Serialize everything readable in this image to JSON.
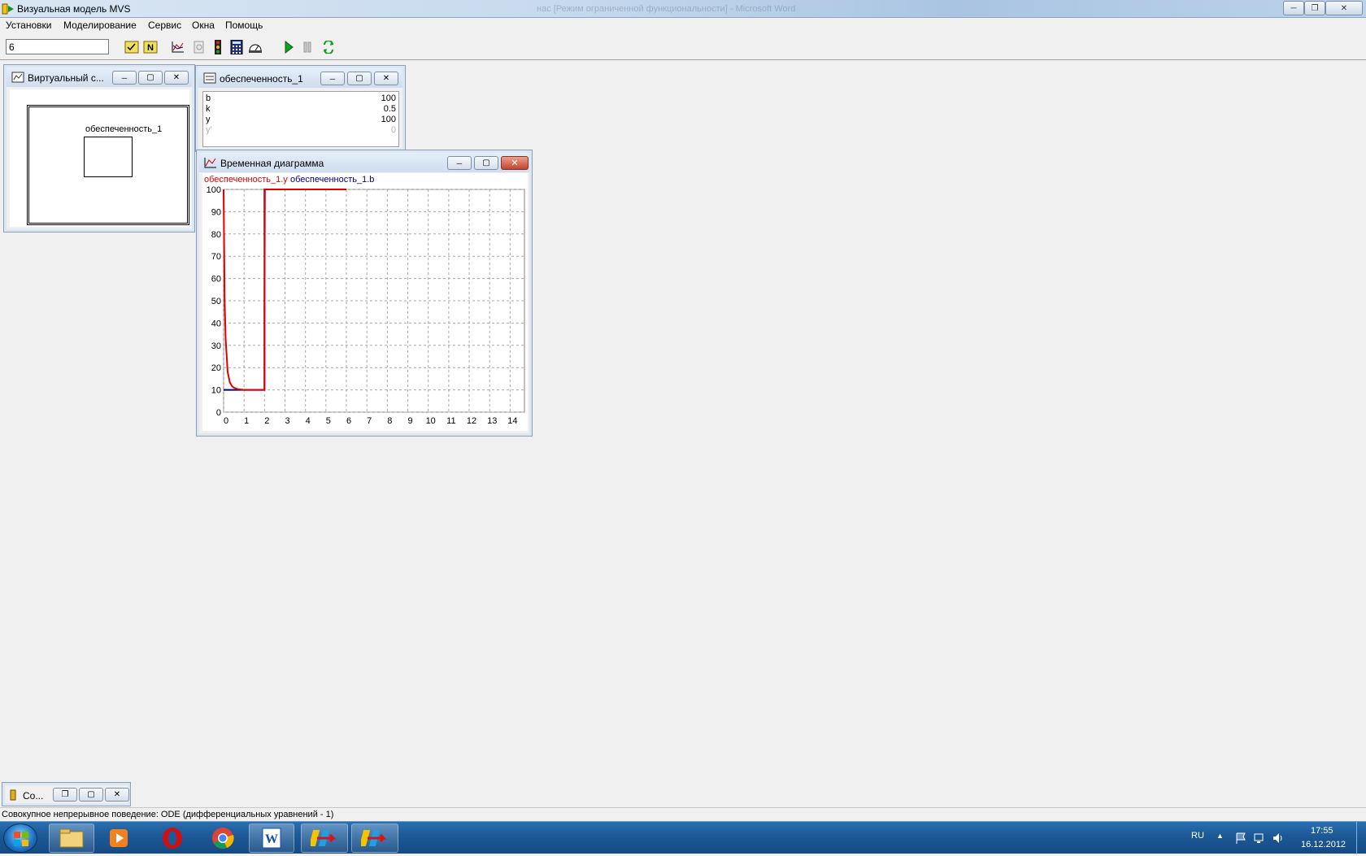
{
  "app": {
    "title": "Визуальная модель MVS",
    "ghost_title": "нас [Режим ограниченной функциональности] - Microsoft Word"
  },
  "menu": [
    "Установки",
    "Моделирование",
    "Сервис",
    "Окна",
    "Помощь"
  ],
  "toolbar": {
    "input_value": "6"
  },
  "virtual_window": {
    "title": "Виртуальный с...",
    "block_label": "обеспеченность_1"
  },
  "table_window": {
    "title": "обеспеченность_1",
    "rows": [
      {
        "key": "b",
        "value": "100"
      },
      {
        "key": "k",
        "value": "0.5"
      },
      {
        "key": "y",
        "value": "100"
      },
      {
        "key": "y'",
        "value": "0"
      }
    ]
  },
  "chart_window": {
    "title": "Временная диаграмма"
  },
  "chart_data": {
    "type": "line",
    "series": [
      {
        "name": "обеспеченность_1.y",
        "color": "#e00000",
        "x": [
          0,
          0.02,
          0.05,
          0.1,
          0.2,
          0.3,
          0.4,
          0.5,
          0.7,
          1.0,
          1.5,
          2.0,
          2.0,
          2.02,
          2.1,
          6.0
        ],
        "y": [
          100,
          80,
          50,
          33,
          18,
          13.5,
          11.8,
          11,
          10.3,
          10,
          10,
          10,
          45,
          100,
          100,
          100
        ]
      },
      {
        "name": "обеспеченность_1.b",
        "color": "#000080",
        "x": [
          0,
          2.0,
          2.0,
          6.0
        ],
        "y": [
          10,
          10,
          100,
          100
        ]
      }
    ],
    "xlim": [
      0,
      14.7
    ],
    "ylim": [
      0,
      100
    ],
    "x_ticks": [
      "0",
      "1",
      "2",
      "3",
      "4",
      "5",
      "6",
      "7",
      "8",
      "9",
      "10",
      "11",
      "12",
      "13",
      "14"
    ],
    "y_ticks": [
      "100",
      "90",
      "80",
      "70",
      "60",
      "50",
      "40",
      "30",
      "20",
      "10",
      "0"
    ],
    "grid": true,
    "legend_position": "top-left"
  },
  "minimized_window": {
    "title": "Со..."
  },
  "status": {
    "text": "Совокупное непрерывное поведение: ODE (дифференциальных уравнений - 1)"
  },
  "tray": {
    "lang": "RU",
    "time": "17:55",
    "date": "16.12.2012"
  }
}
